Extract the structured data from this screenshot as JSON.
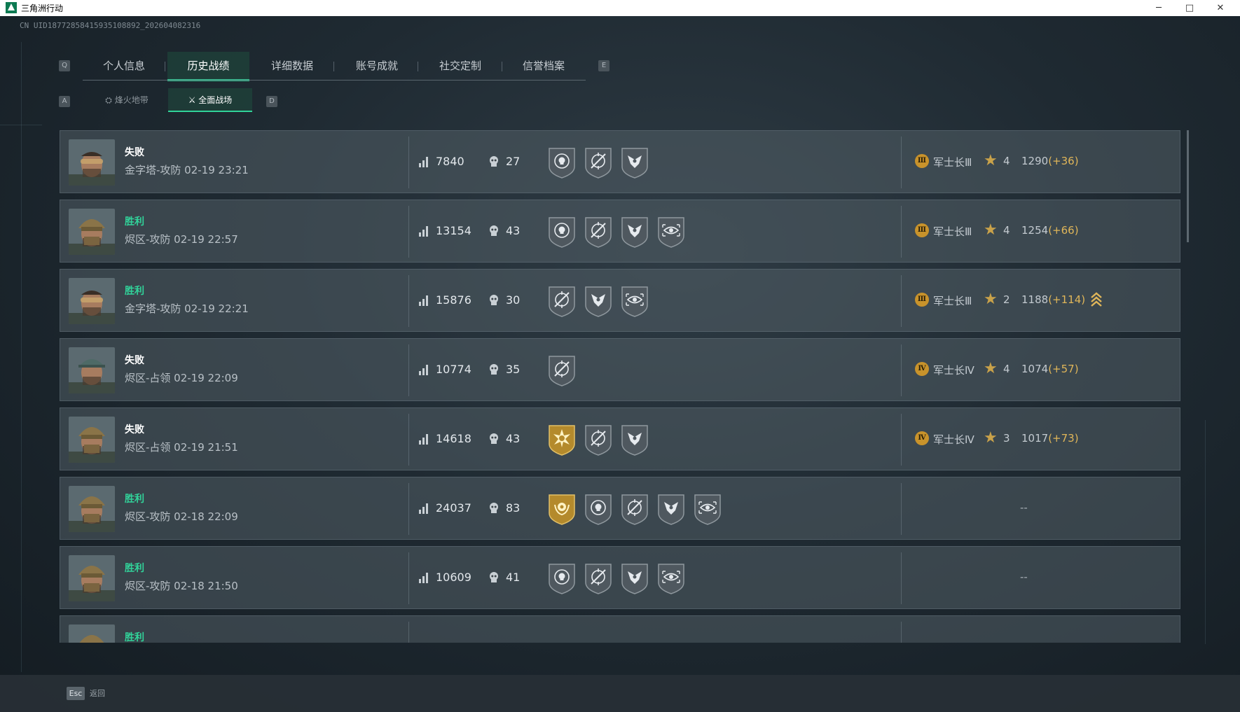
{
  "window": {
    "title": "三角洲行动",
    "minimize": "─",
    "maximize": "□",
    "close": "✕"
  },
  "uid": "CN UID18772858415935108892_202604082316",
  "tabs": {
    "left_key": "Q",
    "right_key": "E",
    "items": [
      {
        "label": "个人信息",
        "active": false
      },
      {
        "label": "历史战绩",
        "active": true
      },
      {
        "label": "详细数据",
        "active": false
      },
      {
        "label": "账号成就",
        "active": false
      },
      {
        "label": "社交定制",
        "active": false
      },
      {
        "label": "信誉档案",
        "active": false
      }
    ]
  },
  "subtabs": {
    "left_key": "A",
    "right_key": "D",
    "items": [
      {
        "label": "烽火地带",
        "icon": "firezone-icon",
        "active": false
      },
      {
        "label": "全面战场",
        "icon": "battlefield-icon",
        "active": true
      }
    ]
  },
  "matches": [
    {
      "result": "失败",
      "win": false,
      "map": "金字塔-攻防 02-19 23:21",
      "avatar": "operator-goggles",
      "score": "7840",
      "kills": "27",
      "medals": [
        "skull-target-medal",
        "crosshair-medal",
        "eagle-medal"
      ],
      "rank_badge": "Ⅲ",
      "rank": "军士长Ⅲ",
      "stars": "4",
      "points": "1290",
      "delta": "(+36)",
      "promoted": false
    },
    {
      "result": "胜利",
      "win": true,
      "map": "烬区-攻防 02-19 22:57",
      "avatar": "operator-helmet",
      "score": "13154",
      "kills": "43",
      "medals": [
        "skull-target-medal",
        "crosshair-medal",
        "eagle-medal",
        "eye-target-medal"
      ],
      "rank_badge": "Ⅲ",
      "rank": "军士长Ⅲ",
      "stars": "4",
      "points": "1254",
      "delta": "(+66)",
      "promoted": false
    },
    {
      "result": "胜利",
      "win": true,
      "map": "金字塔-攻防 02-19 22:21",
      "avatar": "operator-goggles",
      "score": "15876",
      "kills": "30",
      "medals": [
        "crosshair-medal",
        "eagle-medal",
        "eye-target-medal"
      ],
      "rank_badge": "Ⅲ",
      "rank": "军士长Ⅲ",
      "stars": "2",
      "points": "1188",
      "delta": "(+114)",
      "promoted": true
    },
    {
      "result": "失败",
      "win": false,
      "map": "烬区-占领 02-19 22:09",
      "avatar": "operator-cap",
      "score": "10774",
      "kills": "35",
      "medals": [
        "crosshair-medal"
      ],
      "rank_badge": "Ⅳ",
      "rank": "军士长Ⅳ",
      "stars": "4",
      "points": "1074",
      "delta": "(+57)",
      "promoted": false
    },
    {
      "result": "失败",
      "win": false,
      "map": "烬区-占领 02-19 21:51",
      "avatar": "operator-helmet",
      "score": "14618",
      "kills": "43",
      "medals": [
        "gold-burst-medal",
        "crosshair-medal",
        "eagle-medal"
      ],
      "rank_badge": "Ⅳ",
      "rank": "军士长Ⅳ",
      "stars": "3",
      "points": "1017",
      "delta": "(+73)",
      "promoted": false
    },
    {
      "result": "胜利",
      "win": true,
      "map": "烬区-攻防 02-18 22:09",
      "avatar": "operator-helmet",
      "score": "24037",
      "kills": "83",
      "medals": [
        "gold-wreath-medal",
        "skull-target-medal",
        "crosshair-medal",
        "eagle-medal",
        "eye-target-medal"
      ],
      "rank_badge": "",
      "rank": "",
      "stars": "",
      "points": "--",
      "delta": "",
      "promoted": false
    },
    {
      "result": "胜利",
      "win": true,
      "map": "烬区-攻防 02-18 21:50",
      "avatar": "operator-helmet",
      "score": "10609",
      "kills": "41",
      "medals": [
        "skull-target-medal",
        "crosshair-medal",
        "eagle-medal",
        "eye-target-medal"
      ],
      "rank_badge": "",
      "rank": "",
      "stars": "",
      "points": "--",
      "delta": "",
      "promoted": false
    },
    {
      "result": "胜利",
      "win": true,
      "map": "",
      "avatar": "operator-helmet",
      "score": "",
      "kills": "",
      "medals": [],
      "rank_badge": "",
      "rank": "",
      "stars": "",
      "points": "",
      "delta": "",
      "promoted": true
    }
  ],
  "footer": {
    "esc_key": "Esc",
    "back_label": "返回"
  },
  "colors": {
    "win": "#31d39a",
    "accent": "#31d39a",
    "rank_gold": "#c9932b",
    "delta": "#e0b659"
  }
}
